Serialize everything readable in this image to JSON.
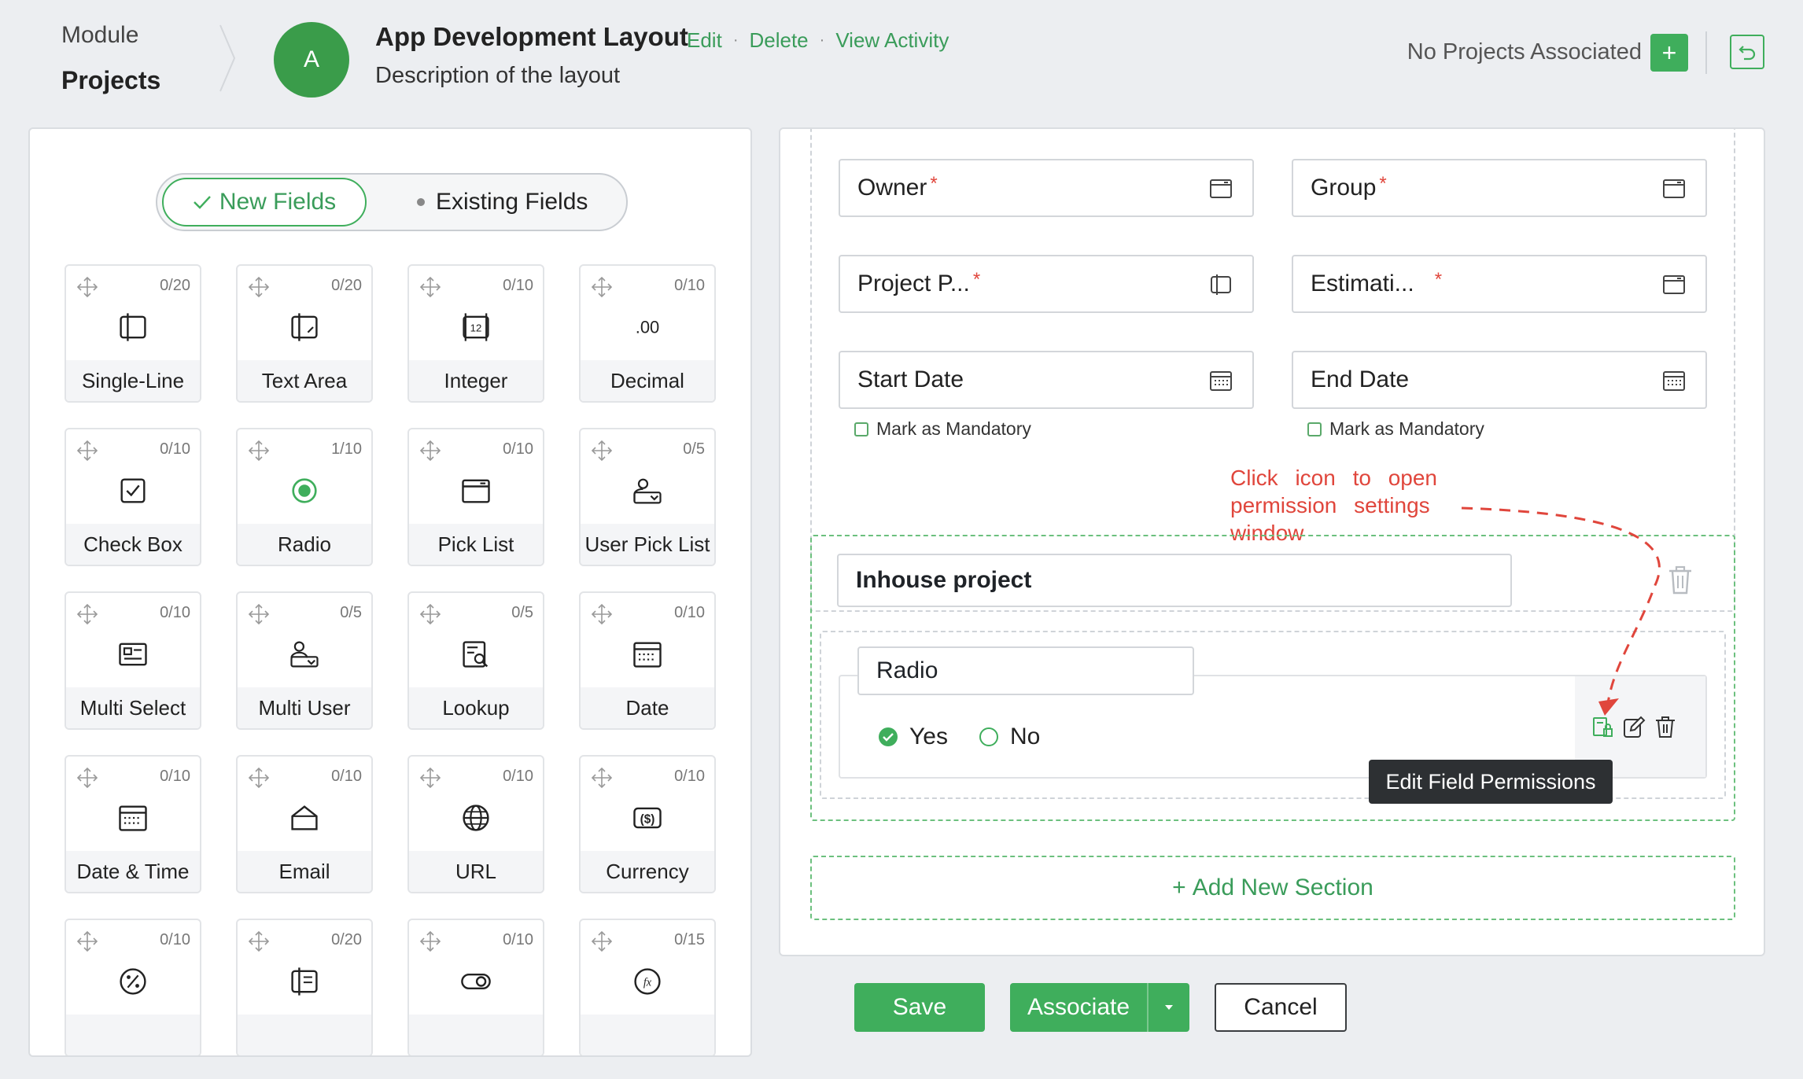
{
  "breadcrumb": {
    "module": "Module",
    "current": "Projects"
  },
  "layout": {
    "avatar_letter": "A",
    "title": "App Development Layout",
    "description": "Description of the layout",
    "links": {
      "edit": "Edit",
      "delete": "Delete",
      "view_activity": "View Activity"
    }
  },
  "header_right": {
    "no_projects": "No Projects Associated",
    "plus": "+"
  },
  "field_toggle": {
    "new": "New Fields",
    "existing": "Existing Fields"
  },
  "field_types": [
    {
      "label": "Single-Line",
      "count": "0/20",
      "icon": "single-line-icon"
    },
    {
      "label": "Text Area",
      "count": "0/20",
      "icon": "text-area-icon"
    },
    {
      "label": "Integer",
      "count": "0/10",
      "icon": "integer-icon"
    },
    {
      "label": "Decimal",
      "count": "0/10",
      "icon": "decimal-icon"
    },
    {
      "label": "Check Box",
      "count": "0/10",
      "icon": "checkbox-icon"
    },
    {
      "label": "Radio",
      "count": "1/10",
      "icon": "radio-icon"
    },
    {
      "label": "Pick List",
      "count": "0/10",
      "icon": "pick-list-icon"
    },
    {
      "label": "User Pick List",
      "count": "0/5",
      "icon": "user-pick-list-icon"
    },
    {
      "label": "Multi Select",
      "count": "0/10",
      "icon": "multi-select-icon"
    },
    {
      "label": "Multi User",
      "count": "0/5",
      "icon": "multi-user-icon"
    },
    {
      "label": "Lookup",
      "count": "0/5",
      "icon": "lookup-icon"
    },
    {
      "label": "Date",
      "count": "0/10",
      "icon": "date-icon"
    },
    {
      "label": "Date & Time",
      "count": "0/10",
      "icon": "date-time-icon"
    },
    {
      "label": "Email",
      "count": "0/10",
      "icon": "email-icon"
    },
    {
      "label": "URL",
      "count": "0/10",
      "icon": "url-icon"
    },
    {
      "label": "Currency",
      "count": "0/10",
      "icon": "currency-icon"
    },
    {
      "label": "",
      "count": "0/10",
      "icon": "percent-icon"
    },
    {
      "label": "",
      "count": "0/20",
      "icon": "multi-line-icon"
    },
    {
      "label": "",
      "count": "0/10",
      "icon": "toggle-icon"
    },
    {
      "label": "",
      "count": "0/15",
      "icon": "formula-icon"
    }
  ],
  "form": {
    "fields": [
      {
        "label": "Owner",
        "required": "*"
      },
      {
        "label": "Group",
        "required": "*"
      },
      {
        "label": "Project P...",
        "required": "*"
      },
      {
        "label": "Estimati...",
        "required": "*"
      },
      {
        "label": "Start Date",
        "required": ""
      },
      {
        "label": "End Date",
        "required": ""
      }
    ],
    "mark_mandatory": "Mark as Mandatory",
    "section_name": "Inhouse project",
    "radio_field": {
      "label": "Radio",
      "options": [
        "Yes",
        "No"
      ],
      "selected": "Yes"
    },
    "tooltip": "Edit Field Permissions",
    "annotation": "Click icon to open permission settings window",
    "add_section": "Add New Section"
  },
  "buttons": {
    "save": "Save",
    "associate": "Associate",
    "cancel": "Cancel"
  },
  "colors": {
    "accent": "#3fae5c",
    "annotation": "#e0463c",
    "tooltip_bg": "#2d3033"
  }
}
